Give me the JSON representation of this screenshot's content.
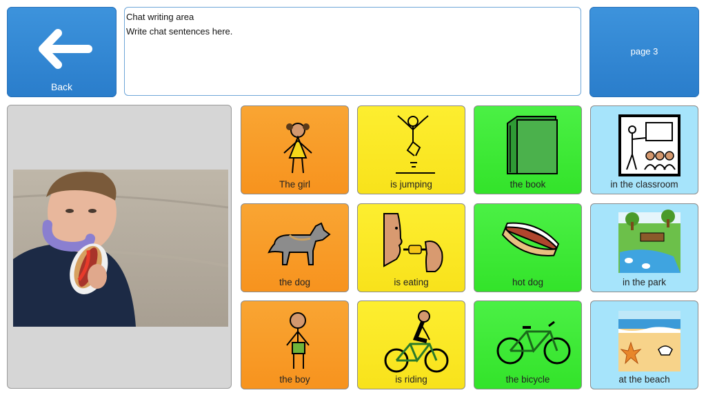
{
  "header": {
    "back_label": "Back",
    "page_label": "page 3",
    "chat_title": "Chat writing area",
    "chat_text": "Write chat sentences here."
  },
  "photo": {
    "description_icon": "photo-boy-eating-hotdog"
  },
  "grid": [
    {
      "label": "The girl",
      "icon": "girl-icon",
      "color": "#f7931e"
    },
    {
      "label": "is jumping",
      "icon": "jumping-icon",
      "color": "#f8e21b"
    },
    {
      "label": "the book",
      "icon": "book-icon",
      "color": "#33e32a"
    },
    {
      "label": "in the classroom",
      "icon": "classroom-icon",
      "color": "#a6e4fb"
    },
    {
      "label": "the dog",
      "icon": "dog-icon",
      "color": "#f7931e"
    },
    {
      "label": "is eating",
      "icon": "eating-icon",
      "color": "#f8e21b"
    },
    {
      "label": "hot dog",
      "icon": "hotdog-icon",
      "color": "#33e32a"
    },
    {
      "label": "in the park",
      "icon": "park-icon",
      "color": "#a6e4fb"
    },
    {
      "label": "the boy",
      "icon": "boy-icon",
      "color": "#f7931e"
    },
    {
      "label": "is riding",
      "icon": "riding-icon",
      "color": "#f8e21b"
    },
    {
      "label": "the bicycle",
      "icon": "bicycle-icon",
      "color": "#33e32a"
    },
    {
      "label": "at the beach",
      "icon": "beach-icon",
      "color": "#a6e4fb"
    }
  ]
}
